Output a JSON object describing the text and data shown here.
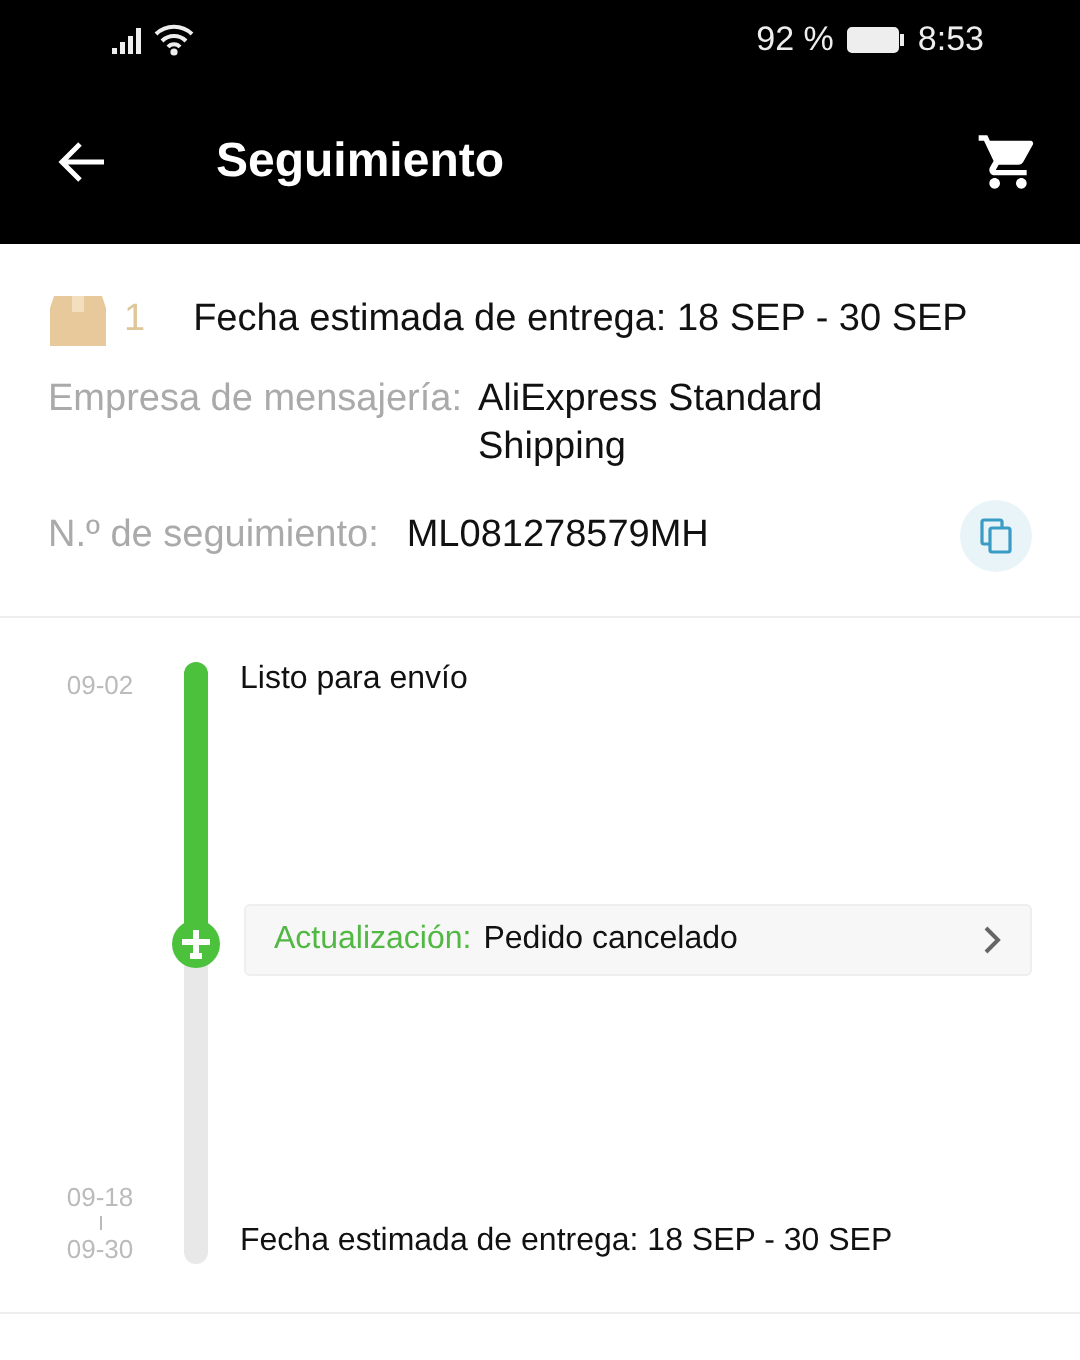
{
  "status_bar": {
    "battery": "92 %",
    "time": "8:53"
  },
  "header": {
    "title": "Seguimiento"
  },
  "summary": {
    "package_count": "1",
    "estimated_delivery": "Fecha estimada de entrega: 18 SEP - 30 SEP",
    "carrier_label": "Empresa de mensajería:",
    "carrier": "AliExpress Standard Shipping",
    "tracking_label": "N.º de seguimiento:",
    "tracking_number": "ML081278579MH"
  },
  "timeline": {
    "level": 0.47,
    "events": [
      {
        "kind": "event",
        "dates": [
          "09-02"
        ],
        "text": "Listo para envío"
      },
      {
        "kind": "update",
        "label": "Actualización:",
        "text": "Pedido cancelado"
      },
      {
        "kind": "event",
        "dates": [
          "09-18",
          "09-30"
        ],
        "text": "Fecha estimada de entrega: 18 SEP - 30 SEP"
      }
    ]
  }
}
